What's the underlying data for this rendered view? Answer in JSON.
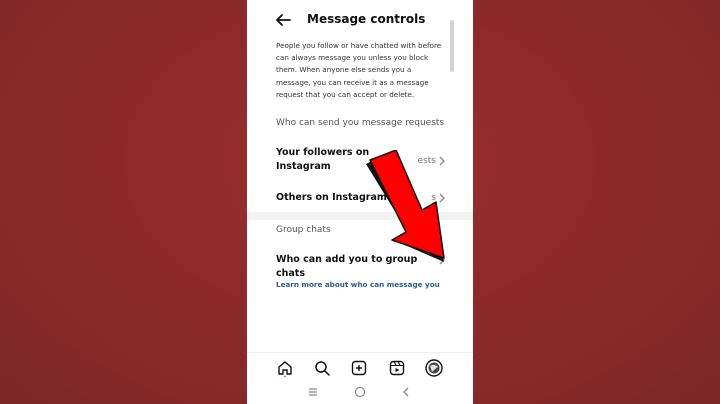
{
  "header": {
    "title": "Message controls"
  },
  "description": "People you follow or have chatted with before can always message you unless you block them. When anyone else sends you a message, you can receive it as a message request that you can accept or delete.",
  "message_requests": {
    "label": "Who can send you message requests",
    "rows": [
      {
        "label": "Your followers on Instagram",
        "value": "ests"
      },
      {
        "label": "Others on Instagram",
        "value": "s"
      }
    ]
  },
  "group_chats": {
    "label": "Group chats",
    "row_label": "Who can add you to group chats"
  },
  "learn_more": "Learn more about who can message you",
  "nav": [
    "home-icon",
    "search-icon",
    "create-icon",
    "reels-icon",
    "profile-avatar"
  ],
  "system_nav": [
    "recents-icon",
    "home-circle-icon",
    "back-chevron-icon"
  ],
  "colors": {
    "background": "#8d2a2a",
    "link": "#2d5a95",
    "arrow": "#ff0000"
  }
}
